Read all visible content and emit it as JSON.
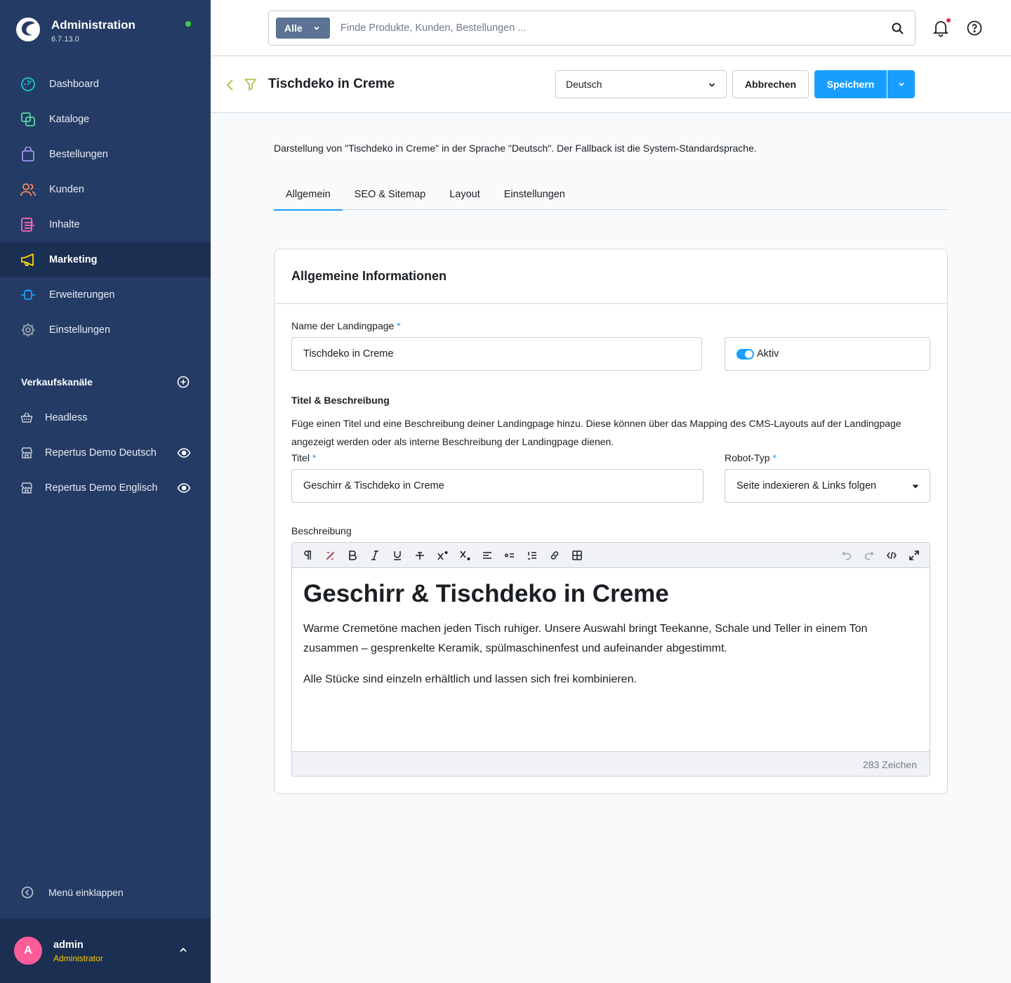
{
  "brand": {
    "title": "Administration",
    "version": "6.7.13.0"
  },
  "nav": [
    {
      "label": "Dashboard",
      "icon": "dashboard-icon",
      "color": "#1cc4d4"
    },
    {
      "label": "Kataloge",
      "icon": "catalog-icon",
      "color": "#57d9a3"
    },
    {
      "label": "Bestellungen",
      "icon": "shopping-bag-icon",
      "color": "#a092f0"
    },
    {
      "label": "Kunden",
      "icon": "users-icon",
      "color": "#f88962"
    },
    {
      "label": "Inhalte",
      "icon": "content-icon",
      "color": "#ff68b4"
    },
    {
      "label": "Marketing",
      "icon": "megaphone-icon",
      "color": "#ffd700",
      "active": true
    },
    {
      "label": "Erweiterungen",
      "icon": "plug-icon",
      "color": "#189eff"
    },
    {
      "label": "Einstellungen",
      "icon": "gear-icon",
      "color": "#9aa8b5"
    }
  ],
  "channels": {
    "title": "Verkaufskanäle",
    "items": [
      {
        "label": "Headless"
      },
      {
        "label": "Repertus Demo Deutsch"
      },
      {
        "label": "Repertus Demo Englisch"
      }
    ]
  },
  "collapse_label": "Menü einklappen",
  "user": {
    "initial": "A",
    "name": "admin",
    "role": "Administrator"
  },
  "search": {
    "type_label": "Alle",
    "placeholder": "Finde Produkte, Kunden, Bestellungen ..."
  },
  "smartbar": {
    "title": "Tischdeko in Creme",
    "language": "Deutsch",
    "cancel_label": "Abbrechen",
    "save_label": "Speichern"
  },
  "info_text": "Darstellung von \"Tischdeko in Creme\" in der Sprache \"Deutsch\". Der Fallback ist die System-Standardsprache.",
  "tabs": [
    {
      "label": "Allgemein",
      "active": true
    },
    {
      "label": "SEO & Sitemap"
    },
    {
      "label": "Layout"
    },
    {
      "label": "Einstellungen"
    }
  ],
  "card": {
    "title": "Allgemeine Informationen",
    "name_label": "Name der Landingpage",
    "required_mark": "*",
    "name_value": "Tischdeko in Creme",
    "active_label": "Aktiv",
    "section_title": "Titel & Beschreibung",
    "section_desc": "Füge einen Titel und eine Beschreibung deiner Landingpage hinzu. Diese können über das Mapping des CMS-Layouts auf der Landingpage angezeigt werden oder als interne Beschreibung der Landingpage dienen.",
    "title_label": "Titel",
    "title_value": "Geschirr & Tischdeko in Creme",
    "robot_label": "Robot-Typ",
    "robot_value": "Seite indexieren & Links folgen",
    "desc_label": "Beschreibung"
  },
  "editor": {
    "heading": "Geschirr & Tischdeko in Creme",
    "paragraph1": "Warme Cremetöne machen jeden Tisch ruhiger. Unsere Auswahl bringt Teekanne, Schale und Teller in einem Ton zusammen – gesprenkelte Keramik, spülmaschinenfest und aufeinander abgestimmt.",
    "paragraph2": "Alle Stücke sind einzeln erhältlich und lassen sich frei kombinieren.",
    "char_count": "283 Zeichen"
  }
}
